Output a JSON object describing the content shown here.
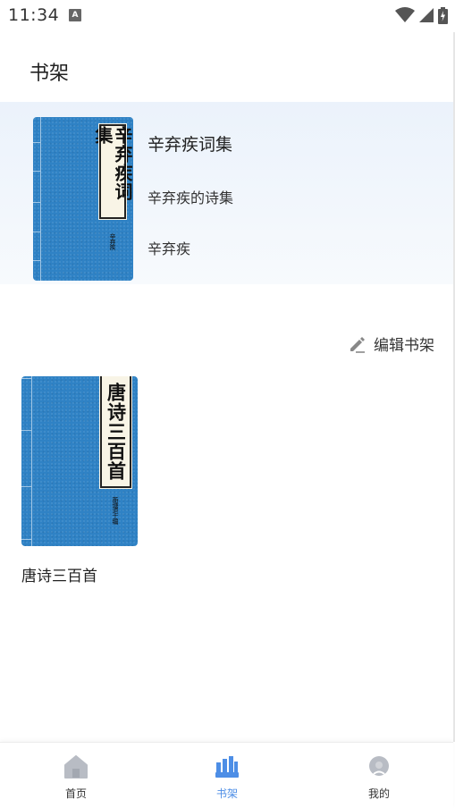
{
  "status_bar": {
    "time": "11:34",
    "notification_letter": "A"
  },
  "header": {
    "title": "书架"
  },
  "recent": {
    "title": "辛弃疾词集",
    "subtitle": "辛弃疾的诗集",
    "author": "辛弃疾",
    "cover_text": "辛弃疾词集",
    "cover_author": "辛弃疾"
  },
  "edit": {
    "label": "编辑书架",
    "icon": "pencil-icon"
  },
  "shelf": {
    "books": [
      {
        "title": "唐诗三百首",
        "cover_text": "唐诗三百首",
        "cover_author": "蘅塘退士编"
      }
    ]
  },
  "nav": {
    "items": [
      {
        "label": "首页",
        "icon": "home-icon",
        "active": false
      },
      {
        "label": "书架",
        "icon": "bookshelf-icon",
        "active": true
      },
      {
        "label": "我的",
        "icon": "profile-icon",
        "active": false
      }
    ]
  },
  "colors": {
    "accent": "#4d8ee6",
    "cover_blue": "#2f82c5",
    "banner_bg": "#ebf2fb",
    "icon_gray": "#b8bcc4"
  }
}
